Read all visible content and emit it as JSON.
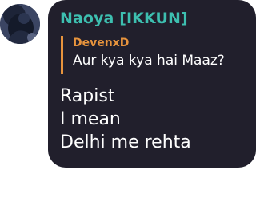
{
  "message": {
    "author": "Naoya [IKKUN]",
    "author_color": "#3dbfb0",
    "bubble_color": "#211f2c",
    "reply": {
      "author": "DevenxD",
      "text": "Aur kya kya hai Maaz?",
      "accent_color": "#e8943d"
    },
    "lines": [
      "Rapist",
      "I mean",
      "Delhi me rehta"
    ]
  },
  "avatar": {
    "icon": "user-avatar-icon"
  }
}
